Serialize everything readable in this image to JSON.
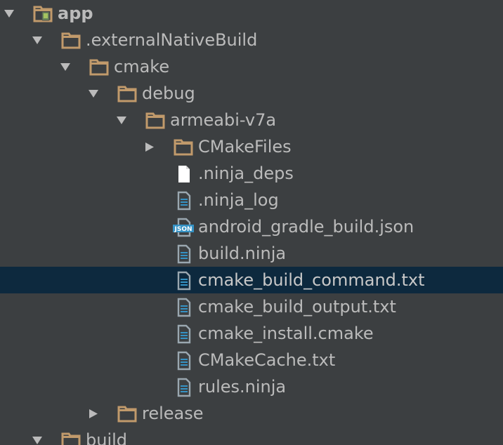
{
  "colors": {
    "background": "#3c3f41",
    "selection": "#0d293e",
    "text": "#bbbbbb",
    "folder": "#c19a6b",
    "file_text_icon": "#9aa7b0",
    "file_text_lines": "#3592c4",
    "json_badge": "#3592c4"
  },
  "tree": {
    "items": [
      {
        "label": "app",
        "depth": 0,
        "toggle": "expanded",
        "icon": "module-folder-icon"
      },
      {
        "label": ".externalNativeBuild",
        "depth": 1,
        "toggle": "expanded",
        "icon": "folder-icon"
      },
      {
        "label": "cmake",
        "depth": 2,
        "toggle": "expanded",
        "icon": "folder-icon"
      },
      {
        "label": "debug",
        "depth": 3,
        "toggle": "expanded",
        "icon": "folder-icon"
      },
      {
        "label": "armeabi-v7a",
        "depth": 4,
        "toggle": "expanded",
        "icon": "folder-icon"
      },
      {
        "label": "CMakeFiles",
        "depth": 5,
        "toggle": "collapsed",
        "icon": "folder-icon"
      },
      {
        "label": ".ninja_deps",
        "depth": 5,
        "toggle": "none",
        "icon": "blank-file-icon"
      },
      {
        "label": ".ninja_log",
        "depth": 5,
        "toggle": "none",
        "icon": "text-file-icon"
      },
      {
        "label": "android_gradle_build.json",
        "depth": 5,
        "toggle": "none",
        "icon": "json-file-icon",
        "badge": "JSON"
      },
      {
        "label": "build.ninja",
        "depth": 5,
        "toggle": "none",
        "icon": "text-file-icon"
      },
      {
        "label": "cmake_build_command.txt",
        "depth": 5,
        "toggle": "none",
        "icon": "text-file-icon",
        "selected": true
      },
      {
        "label": "cmake_build_output.txt",
        "depth": 5,
        "toggle": "none",
        "icon": "text-file-icon"
      },
      {
        "label": "cmake_install.cmake",
        "depth": 5,
        "toggle": "none",
        "icon": "text-file-icon"
      },
      {
        "label": "CMakeCache.txt",
        "depth": 5,
        "toggle": "none",
        "icon": "text-file-icon"
      },
      {
        "label": "rules.ninja",
        "depth": 5,
        "toggle": "none",
        "icon": "text-file-icon"
      },
      {
        "label": "release",
        "depth": 3,
        "toggle": "collapsed",
        "icon": "folder-icon"
      },
      {
        "label": "build",
        "depth": 1,
        "toggle": "expanded",
        "icon": "folder-icon"
      }
    ]
  }
}
